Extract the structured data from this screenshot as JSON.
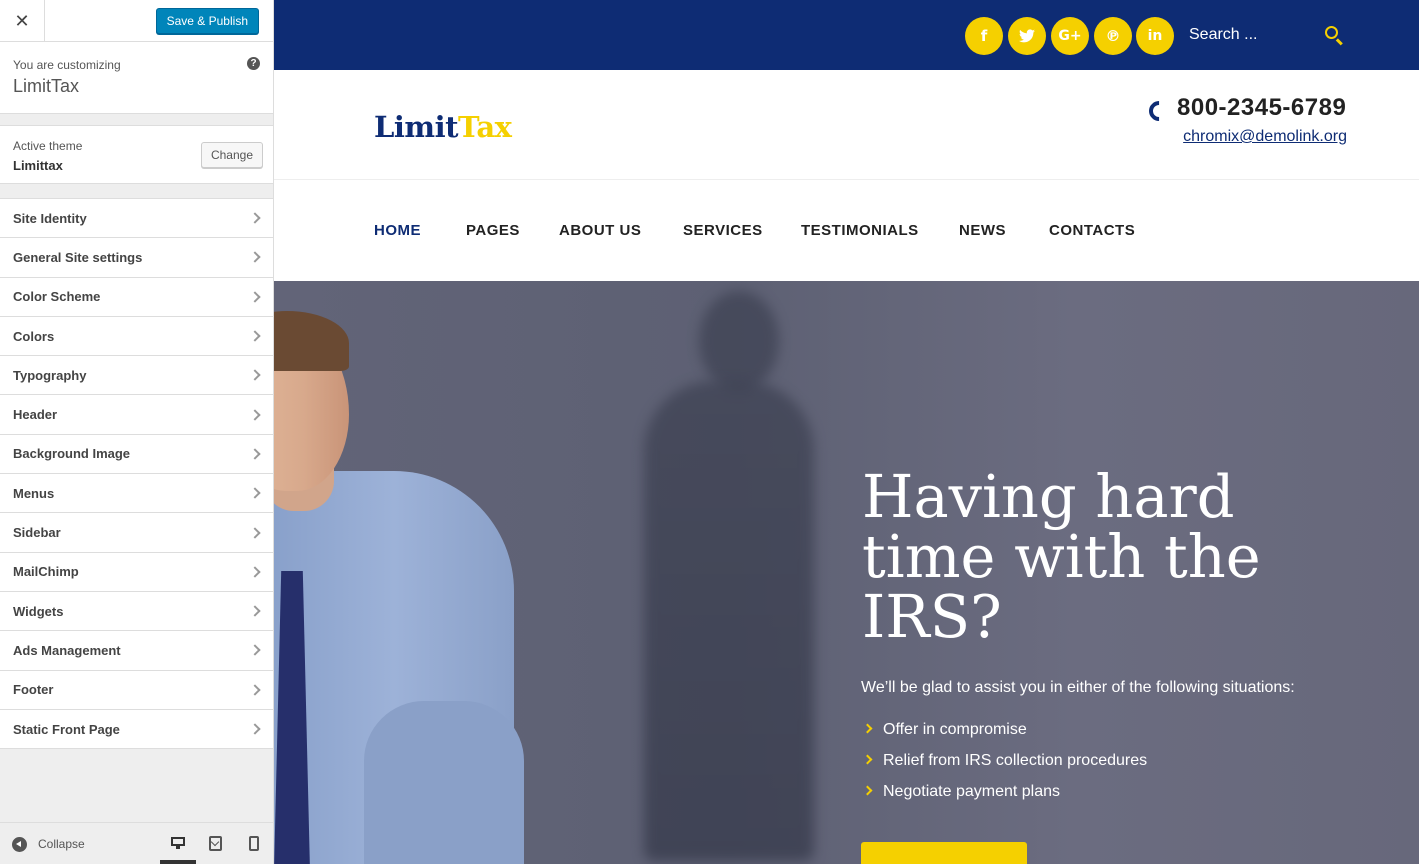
{
  "customizer": {
    "close_label": "✕",
    "save_label": "Save & Publish",
    "customizing_label": "You are customizing",
    "site_name": "LimitTax",
    "help_glyph": "?",
    "active_theme_label": "Active theme",
    "active_theme_name": "Limittax",
    "change_label": "Change",
    "sections": [
      "Site Identity",
      "General Site settings",
      "Color Scheme",
      "Colors",
      "Typography",
      "Header",
      "Background Image",
      "Menus",
      "Sidebar",
      "MailChimp",
      "Widgets",
      "Ads Management",
      "Footer",
      "Static Front Page"
    ],
    "collapse_label": "Collapse",
    "devices": [
      "desktop",
      "tablet",
      "mobile"
    ],
    "active_device": "desktop"
  },
  "site": {
    "colors": {
      "primary": "#0e2c74",
      "accent": "#f5d000"
    },
    "social": [
      {
        "icon": "facebook-icon",
        "glyph": "f"
      },
      {
        "icon": "twitter-icon",
        "glyph": "🐦"
      },
      {
        "icon": "google-plus-icon",
        "glyph": "G+"
      },
      {
        "icon": "pinterest-icon",
        "glyph": "℗"
      },
      {
        "icon": "linkedin-icon",
        "glyph": "in"
      }
    ],
    "search_placeholder": "Search ...",
    "logo_part1": "Limit",
    "logo_part2": "Tax",
    "phone": "800-2345-6789",
    "email": "chromix@demolink.org",
    "nav": [
      "HOME",
      "PAGES",
      "ABOUT US",
      "SERVICES",
      "TESTIMONIALS",
      "NEWS",
      "CONTACTS"
    ],
    "nav_active": "HOME",
    "hero": {
      "title": "Having hard time with the IRS?",
      "subtitle": "We’ll be glad to assist you in either of the following situations:",
      "items": [
        "Offer in compromise",
        "Relief from IRS collection procedures",
        "Negotiate payment plans"
      ]
    }
  }
}
